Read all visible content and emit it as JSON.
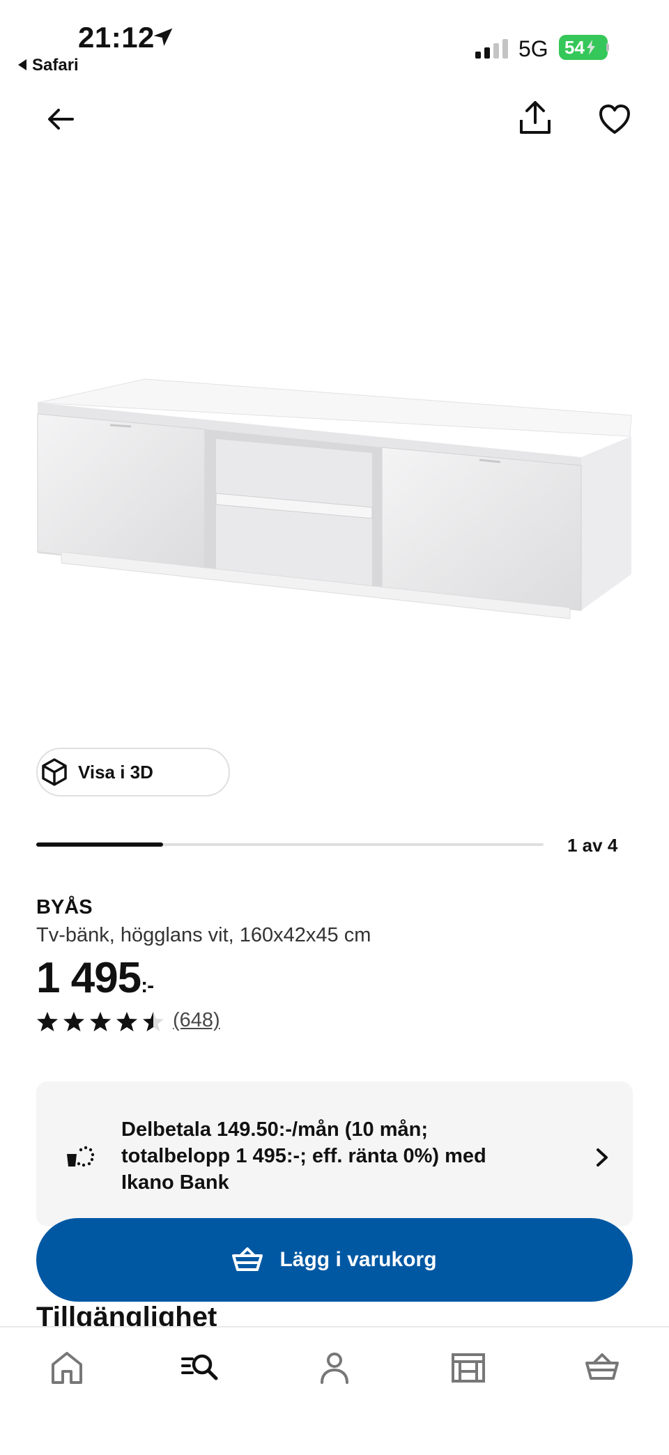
{
  "status_bar": {
    "time": "21:12",
    "back_app": "Safari",
    "network": "5G",
    "battery": "54"
  },
  "product": {
    "name": "BYÅS",
    "description": "Tv-bänk, högglans vit, 160x42x45 cm",
    "price": "1 495",
    "price_suffix": ":-",
    "rating": 4.5,
    "review_count": "(648)"
  },
  "gallery": {
    "view_3d_label": "Visa i 3D",
    "position_label": "1 av 4",
    "current_index": 1,
    "total": 4
  },
  "payment": {
    "text": "Delbetala 149.50:-/mån (10 mån; totalbelopp 1 495:-; eff. ränta 0%) med Ikano Bank"
  },
  "actions": {
    "add_to_cart": "Lägg i varukorg"
  },
  "next_section": {
    "heading": "Tillgänglighet"
  },
  "tabbar": {
    "items": [
      "home-icon",
      "search-icon",
      "profile-icon",
      "store-icon",
      "cart-icon"
    ]
  },
  "colors": {
    "primary": "#0058a3",
    "battery": "#35c759"
  }
}
